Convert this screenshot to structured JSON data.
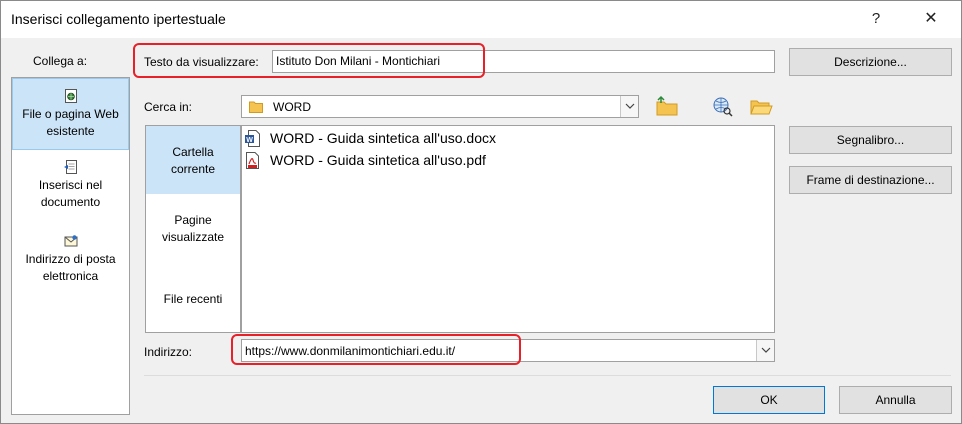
{
  "dialog": {
    "title": "Inserisci collegamento ipertestuale",
    "help_label": "?",
    "close_label": "✕"
  },
  "linkbar": {
    "label": "Collega a:",
    "items": [
      {
        "icon": "web-page-icon",
        "line1": "File o pagina Web",
        "line2": "esistente",
        "selected": true
      },
      {
        "icon": "document-place-icon",
        "line1": "Inserisci nel",
        "line2": "documento",
        "selected": false
      },
      {
        "icon": "email-icon",
        "line1": "Indirizzo di posta",
        "line2": "elettronica",
        "selected": false
      }
    ]
  },
  "display_text": {
    "label": "Testo da visualizzare:",
    "value": "Istituto Don Milani - Montichiari"
  },
  "look_in": {
    "label": "Cerca in:",
    "value": "WORD"
  },
  "nav": {
    "items": [
      {
        "line1": "Cartella",
        "line2": "corrente",
        "selected": true
      },
      {
        "line1": "Pagine",
        "line2": "visualizzate",
        "selected": false
      },
      {
        "line1": "File recenti",
        "line2": "",
        "selected": false
      }
    ]
  },
  "files": [
    {
      "name": "WORD - Guida sintetica all'uso.docx",
      "icon": "word-document-icon"
    },
    {
      "name": "WORD - Guida sintetica all'uso.pdf",
      "icon": "pdf-document-icon"
    }
  ],
  "address": {
    "label": "Indirizzo:",
    "value": "https://www.donmilanimontichiari.edu.it/"
  },
  "buttons": {
    "screentip": "Descrizione...",
    "bookmark": "Segnalibro...",
    "target_frame": "Frame di destinazione...",
    "ok": "OK",
    "cancel": "Annulla"
  },
  "colors": {
    "selection": "#cce4f7",
    "annotation_red": "#e8202a"
  }
}
